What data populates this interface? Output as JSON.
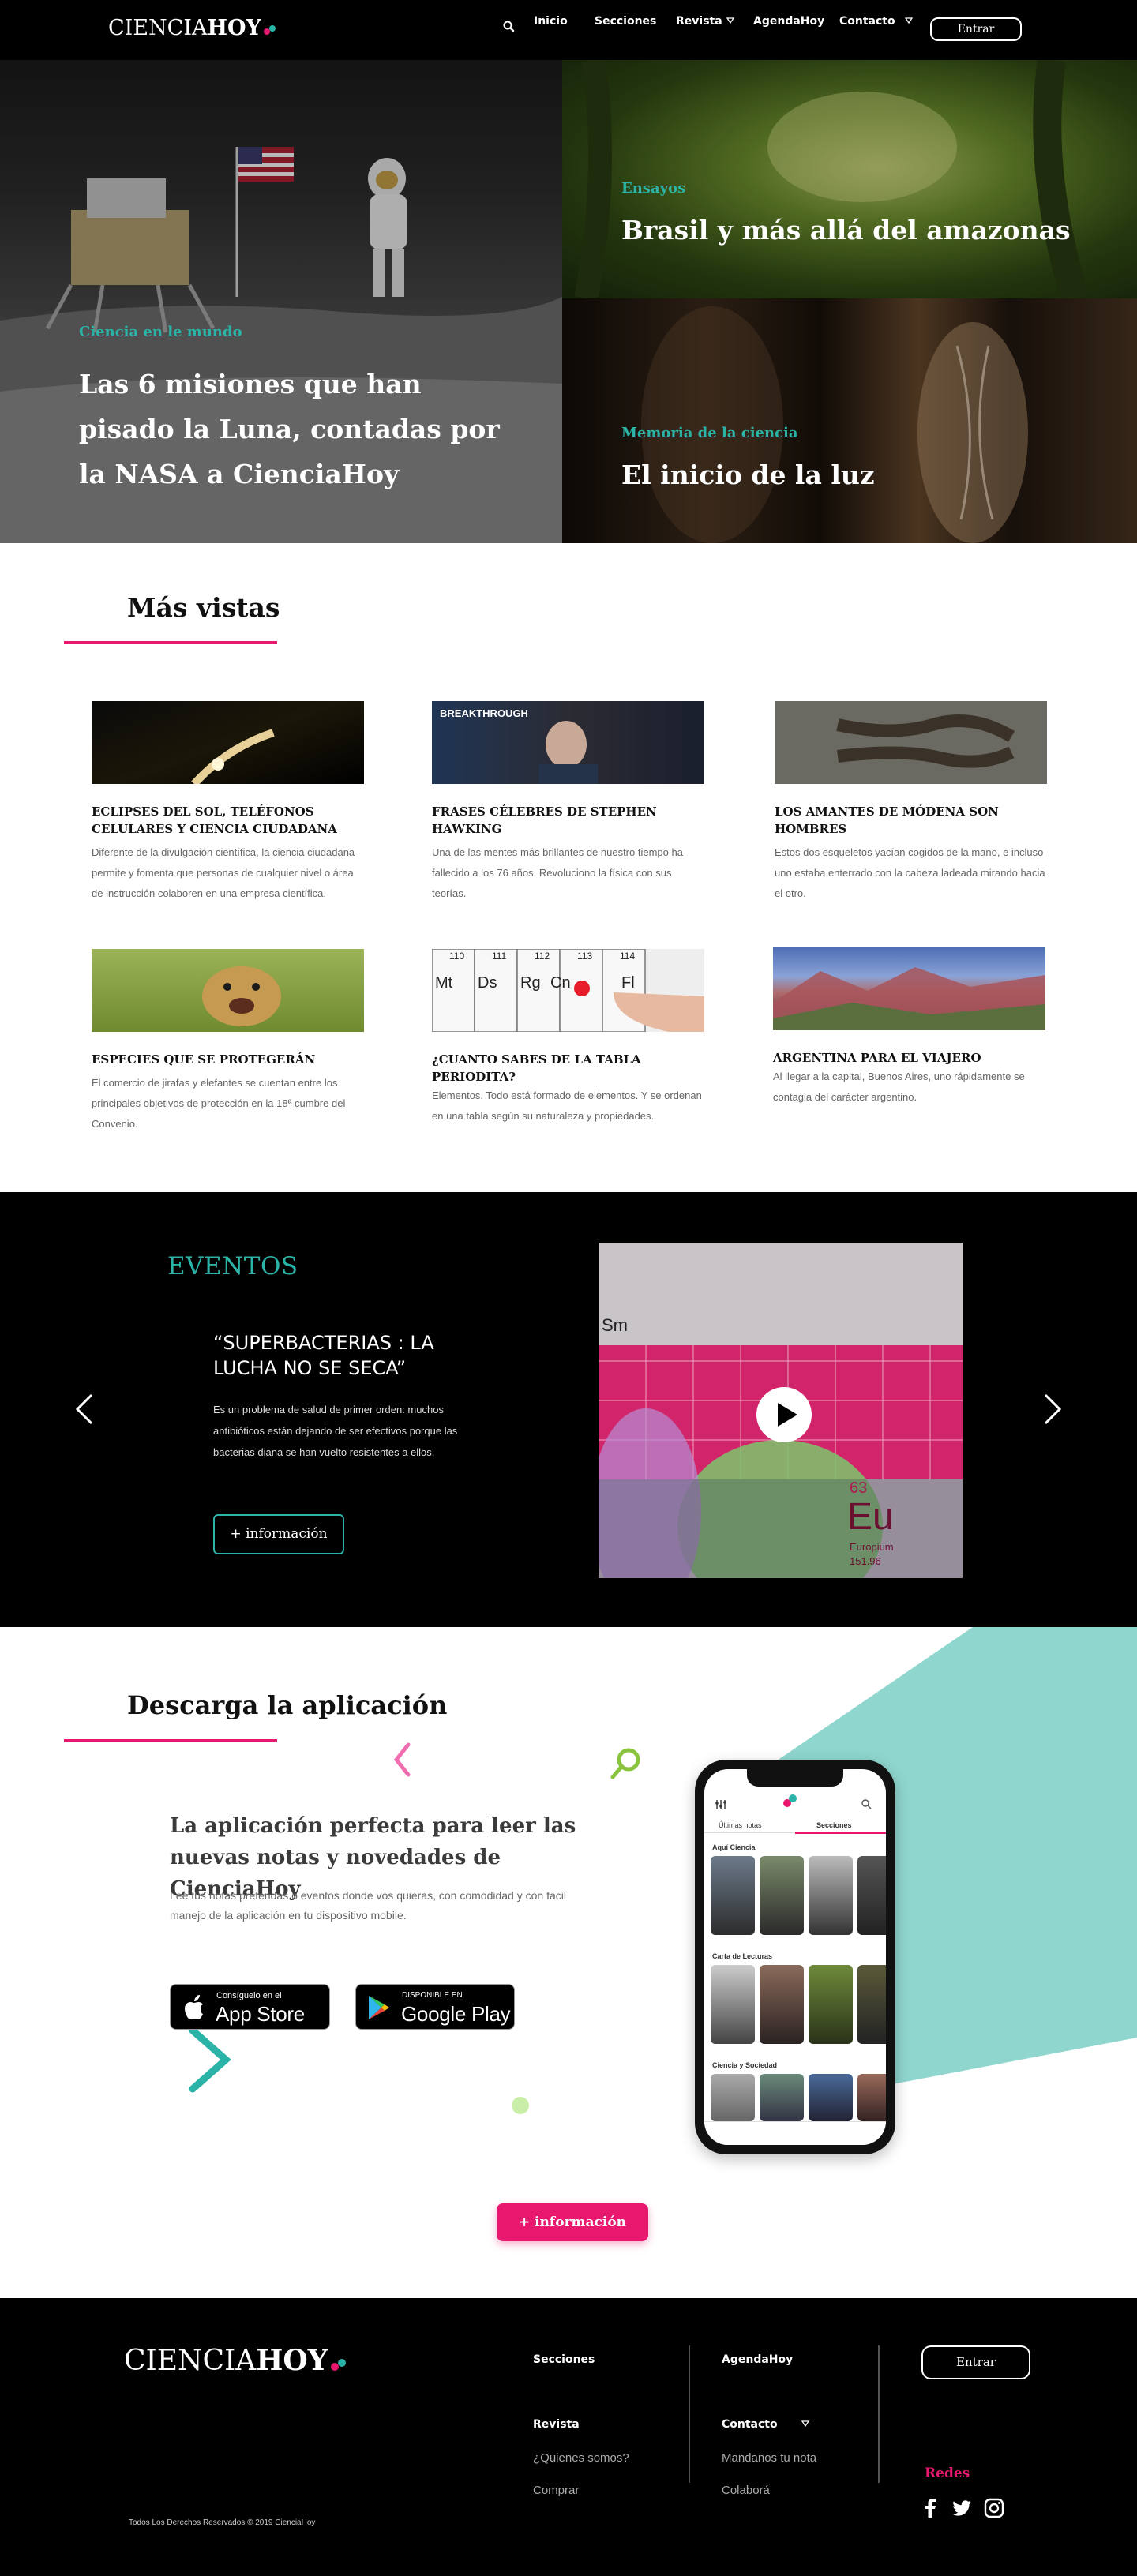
{
  "brand": {
    "name_part1": "CIENCIA",
    "name_part2": "HOY"
  },
  "nav": {
    "links": [
      "Inicio",
      "Secciones",
      "Revista",
      "AgendaHoy",
      "Contacto"
    ],
    "login_label": "Entrar"
  },
  "hero": {
    "main": {
      "category": "Ciencia en le mundo",
      "title": "Las 6 misiones que han pisado la Luna, contadas  por la NASA a CienciaHoy"
    },
    "top_right": {
      "category": "Ensayos",
      "title": "Brasil y más allá del amazonas"
    },
    "bottom_right": {
      "category": "Memoria de la ciencia",
      "title": "El inicio de la luz"
    }
  },
  "most_viewed": {
    "heading": "Más vistas",
    "cards": [
      {
        "title": "ECLIPSES DEL SOL, TELÉFONOS CELULARES Y CIENCIA CIUDADANA",
        "text": "Diferente de la divulgación científica, la ciencia ciudadana permite y fomenta que personas de cualquier nivel o área de instrucción colaboren en una empresa científica."
      },
      {
        "title": "FRASES CÉLEBRES DE STEPHEN HAWKING",
        "text": "Una de las mentes más brillantes de nuestro tiempo ha fallecido a los 76 años. Revoluciono la física con sus teorías."
      },
      {
        "title": "LOS AMANTES DE MÓDENA SON HOMBRES",
        "text": "Estos dos esqueletos yacían cogidos de la mano, e incluso uno estaba enterrado con la cabeza ladeada mirando hacia el otro."
      },
      {
        "title": "ESPECIES QUE SE PROTEGERÁN",
        "text": "El comercio de jirafas y elefantes se cuentan entre los principales objetivos de protección en la 18ª cumbre del Convenio."
      },
      {
        "title": "¿CUANTO SABES DE LA TABLA PERIODITA?",
        "text": "Elementos. Todo está formado de elementos. Y se ordenan en una tabla según su naturaleza y propiedades."
      },
      {
        "title": "ARGENTINA PARA EL VIAJERO",
        "text": "Al llegar a la capital, Buenos Aires, uno rápidamente se contagia del carácter argentino."
      }
    ],
    "hawking_banner": "BREAKTHROUGH",
    "periodic_labels": [
      "110",
      "111",
      "112",
      "113",
      "114",
      "Mt",
      "Ds",
      "Rg",
      "Cn",
      "Fl"
    ]
  },
  "events": {
    "heading": "EVENTOS",
    "title": "“SUPERBACTERIAS : LA LUCHA NO SE SECA”",
    "description": "Es un problema de salud de primer orden: muchos antibióticos están dejando de ser efectivos porque las bacterias diana se han vuelto resistentes a ellos.",
    "button_label": "+ información",
    "media_labels": {
      "big_symbol": "Eu",
      "number": "63",
      "name": "Europium",
      "mass": "151.96",
      "left_symbol": "Sm"
    }
  },
  "app": {
    "heading": "Descarga la aplicación",
    "title": "La aplicación perfecta para leer las nuevas notas y  novedades de CienciaHoy",
    "description": "Lee tus notas preferidas o eventos donde vos quieras, con comodidad y con facil manejo de la aplicación en tu dispositivo mobile.",
    "appstore_small": "Consíguelo en el",
    "appstore_big": "App Store",
    "gplay_small": "DISPONIBLE EN",
    "gplay_big": "Google Play",
    "button_label": "+ información",
    "phone": {
      "tabs": [
        "Últimas notas",
        "Secciones"
      ],
      "sections": [
        "Aquí Ciencia",
        "Carta de Lecturas",
        "Ciencia y Sociedad"
      ]
    }
  },
  "footer": {
    "col1": [
      "Secciones",
      "Revista",
      "¿Quienes somos?",
      "Comprar"
    ],
    "col2": [
      "AgendaHoy",
      "Contacto",
      "Mandanos tu nota",
      "Colaborá"
    ],
    "login_label": "Entrar",
    "social_heading": "Redes",
    "copyright": "Todos Los Derechos Reservados © 2019 CienciaHoy"
  },
  "colors": {
    "pink": "#e8186e",
    "teal": "#2ab3a6",
    "mint": "#8fd6ce"
  }
}
